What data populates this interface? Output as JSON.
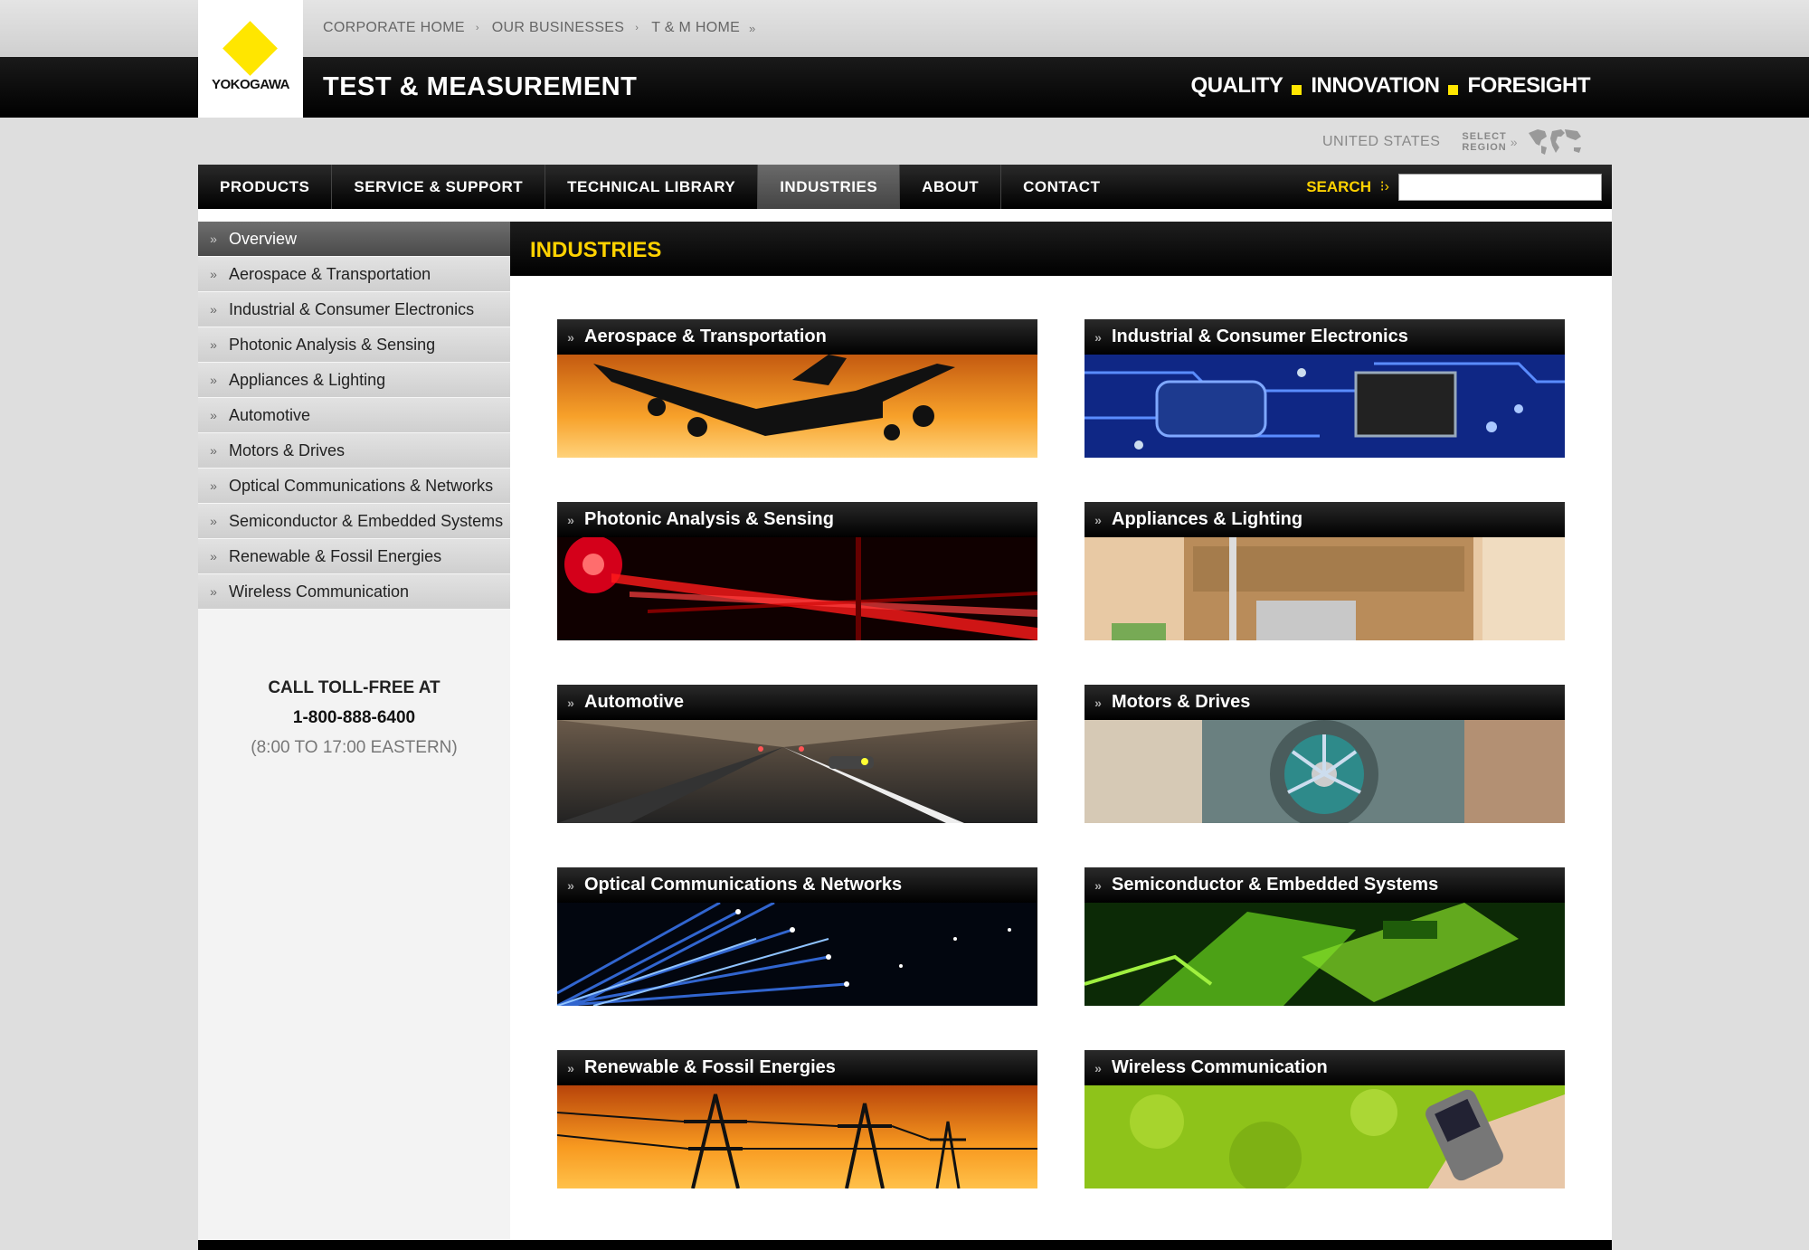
{
  "logo": {
    "text": "YOKOGAWA"
  },
  "util_links": [
    "CORPORATE HOME",
    "OUR BUSINESSES",
    "T & M HOME"
  ],
  "site_title": "TEST & MEASUREMENT",
  "tagline": [
    "QUALITY",
    "INNOVATION",
    "FORESIGHT"
  ],
  "region": {
    "country": "UNITED STATES",
    "select_line1": "SELECT",
    "select_line2": "REGION"
  },
  "nav": {
    "items": [
      "PRODUCTS",
      "SERVICE & SUPPORT",
      "TECHNICAL LIBRARY",
      "INDUSTRIES",
      "ABOUT",
      "CONTACT"
    ],
    "active": "INDUSTRIES",
    "search_label": "SEARCH",
    "search_value": ""
  },
  "sidebar": {
    "items": [
      "Overview",
      "Aerospace & Transportation",
      "Industrial & Consumer Electronics",
      "Photonic Analysis & Sensing",
      "Appliances & Lighting",
      "Automotive",
      "Motors & Drives",
      "Optical Communications & Networks",
      "Semiconductor & Embedded Systems",
      "Renewable & Fossil Energies",
      "Wireless Communication"
    ],
    "active": "Overview",
    "call": {
      "line1": "CALL TOLL-FREE AT",
      "phone": "1-800-888-6400",
      "hours": "(8:00 TO 17:00 EASTERN)"
    }
  },
  "main": {
    "heading": "INDUSTRIES",
    "tiles": [
      {
        "title": "Aerospace & Transportation",
        "image": "airplane-sunset-image"
      },
      {
        "title": "Industrial & Consumer Electronics",
        "image": "circuit-board-image"
      },
      {
        "title": "Photonic Analysis & Sensing",
        "image": "red-laser-image"
      },
      {
        "title": "Appliances & Lighting",
        "image": "kitchen-interior-image"
      },
      {
        "title": "Automotive",
        "image": "tunnel-traffic-image"
      },
      {
        "title": "Motors & Drives",
        "image": "turbine-image"
      },
      {
        "title": "Optical Communications & Networks",
        "image": "fiber-optics-image"
      },
      {
        "title": "Semiconductor & Embedded Systems",
        "image": "green-chip-image"
      },
      {
        "title": "Renewable & Fossil Energies",
        "image": "power-lines-image"
      },
      {
        "title": "Wireless Communication",
        "image": "mobile-phone-image"
      }
    ]
  },
  "colors": {
    "accent_yellow": "#ffd200",
    "logo_yellow": "#ffe600",
    "nav_black": "#000000"
  }
}
